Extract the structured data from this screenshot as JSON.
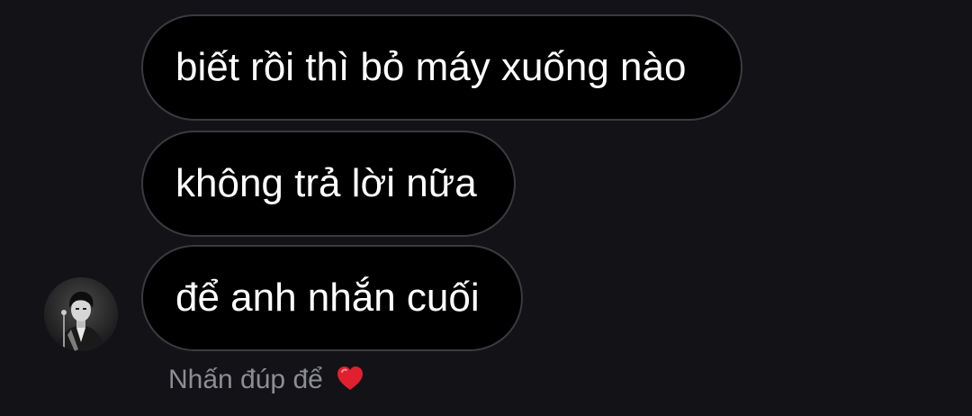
{
  "messages": [
    {
      "text": "biết rồi thì bỏ máy xuống nào"
    },
    {
      "text": "không trả lời nữa"
    },
    {
      "text": "để anh nhắn cuối"
    }
  ],
  "reaction_hint": {
    "text": "Nhấn đúp để",
    "icon": "heart-icon",
    "icon_color": "#e0202e"
  },
  "colors": {
    "background": "#121217",
    "bubble": "#000000",
    "bubble_border": "#3a3a40",
    "hint_text": "#8d8d95"
  }
}
